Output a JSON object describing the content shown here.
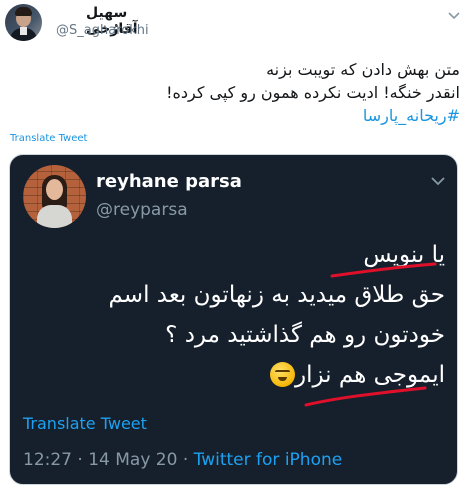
{
  "tweet": {
    "author_name": "سهیل آقارُخی",
    "author_handle": "@S_agharokhi",
    "text_lines": [
      "متن بهش دادن که تویبت بزنه",
      "انقدر خنگه! ادیت نکرده همون رو کپی کرده!"
    ],
    "hashtag": "#ریحانه_پارسا",
    "translate_label": "Translate Tweet"
  },
  "embedded": {
    "name": "reyhane parsa",
    "handle": "@reyparsa",
    "text_lines": [
      "یا بنویس",
      "حق طلاق میدید به زنهاتون بعد اسم",
      "خودتون رو هم گذاشتید مرد ؟",
      "ایموجی هم نزار"
    ],
    "translate_label": "Translate Tweet",
    "time": "12:27",
    "separator": "·",
    "date": "14 May 20",
    "source": "Twitter for iPhone"
  },
  "icons": {
    "menu_caret": "chevron-down-icon",
    "emoji": "triumph-face-emoji"
  },
  "colors": {
    "link": "#1b95e0",
    "embedded_bg": "#16202c",
    "embedded_link": "#1da1f2",
    "scribble": "#e0102a"
  }
}
